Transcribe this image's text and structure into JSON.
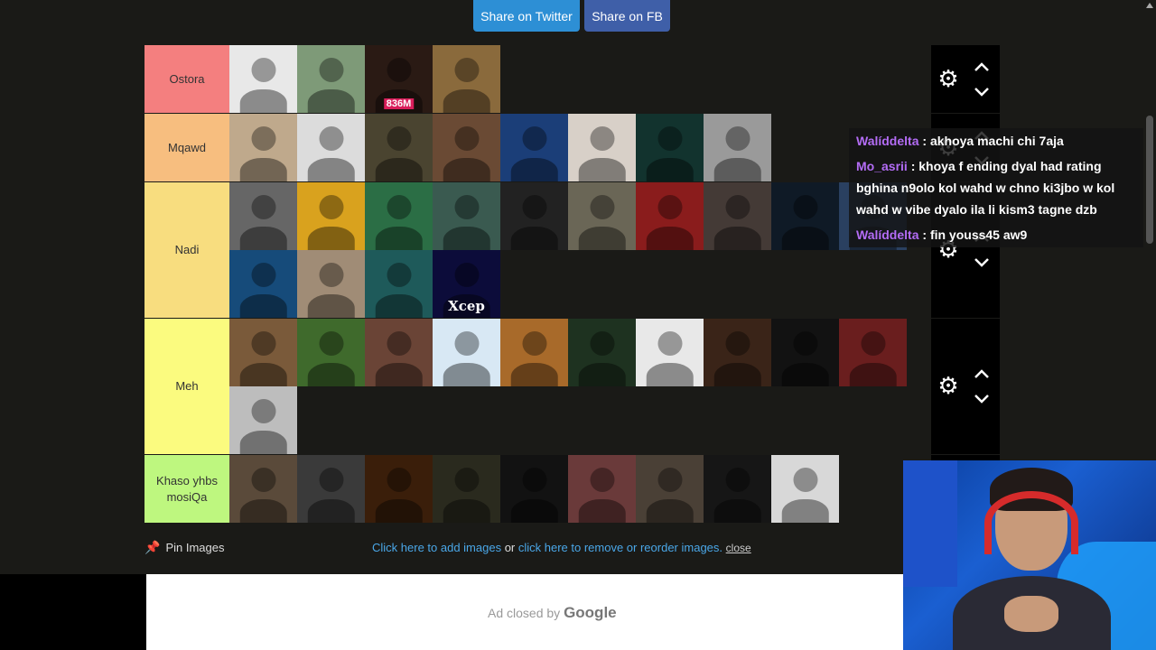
{
  "share": {
    "twitter": "Share on Twitter",
    "facebook": "Share on FB"
  },
  "tiers": [
    {
      "name": "Ostora",
      "color": "#f47f7f",
      "items": [
        {
          "bg": "#e8e8e8"
        },
        {
          "bg": "#7e9a78"
        },
        {
          "bg": "#2a1a14",
          "tag": "836M"
        },
        {
          "bg": "#8a6a3c"
        }
      ]
    },
    {
      "name": "Mqawd",
      "color": "#f7be7f",
      "items": [
        {
          "bg": "#bfa98c"
        },
        {
          "bg": "#dcdcdc"
        },
        {
          "bg": "#4a4430"
        },
        {
          "bg": "#6a4a34"
        },
        {
          "bg": "#1b3e78"
        },
        {
          "bg": "#d8d0c8"
        },
        {
          "bg": "#12332e"
        },
        {
          "bg": "#9a9a9a"
        }
      ]
    },
    {
      "name": "Nadi",
      "color": "#f8dd7f",
      "items": [
        {
          "bg": "#666"
        },
        {
          "bg": "#d9a21e"
        },
        {
          "bg": "#2b6e45"
        },
        {
          "bg": "#3a5a50"
        },
        {
          "bg": "#222"
        },
        {
          "bg": "#6a6656"
        },
        {
          "bg": "#8a1c1c"
        },
        {
          "bg": "#443a36"
        },
        {
          "bg": "#0f1a26"
        },
        {
          "bg": "#2a4060"
        },
        {
          "bg": "#164b7a"
        },
        {
          "bg": "#a08c76"
        },
        {
          "bg": "#1e5a5a"
        },
        {
          "bg": "#0c0c3a",
          "tag": "Xcep",
          "white": true
        }
      ]
    },
    {
      "name": "Meh",
      "color": "#fbfb7f",
      "items": [
        {
          "bg": "#7a5a3a"
        },
        {
          "bg": "#3f6a2c"
        },
        {
          "bg": "#6a4436"
        },
        {
          "bg": "#d8e8f4"
        },
        {
          "bg": "#a86a2a"
        },
        {
          "bg": "#1e3220"
        },
        {
          "bg": "#e8e8e8"
        },
        {
          "bg": "#3a2418"
        },
        {
          "bg": "#121212"
        },
        {
          "bg": "#6a1e1e"
        },
        {
          "bg": "#bdbdbd"
        }
      ]
    },
    {
      "name": "Khaso yhbs mosiQa",
      "color": "#bef77f",
      "items": [
        {
          "bg": "#5a4a3a"
        },
        {
          "bg": "#3a3a3a"
        },
        {
          "bg": "#3a1e0a"
        },
        {
          "bg": "#2a2a1e"
        },
        {
          "bg": "#121212"
        },
        {
          "bg": "#6a3a3a"
        },
        {
          "bg": "#4a4036"
        },
        {
          "bg": "#161616"
        },
        {
          "bg": "#d8d8d8"
        }
      ]
    }
  ],
  "chat": [
    {
      "user": "Walíddelta",
      "message": " : akhoya machi chi 7aja"
    },
    {
      "user": "Mo_asrii",
      "message": " : khoya f ending dyal had rating bghina n9olo kol wahd w chno ki3jbo w kol wahd w vibe dyalo ila li kism3 tagne dzb"
    },
    {
      "user": "Walíddelta",
      "message": " : fin youss45 aw9"
    }
  ],
  "bottom": {
    "pin_label": "Pin Images",
    "add_link": "Click here to add images",
    "or_text": " or ",
    "remove_link": "click here to remove or reorder images.",
    "close_link": "close"
  },
  "ad": {
    "text": "Ad closed by ",
    "brand": "Google"
  }
}
